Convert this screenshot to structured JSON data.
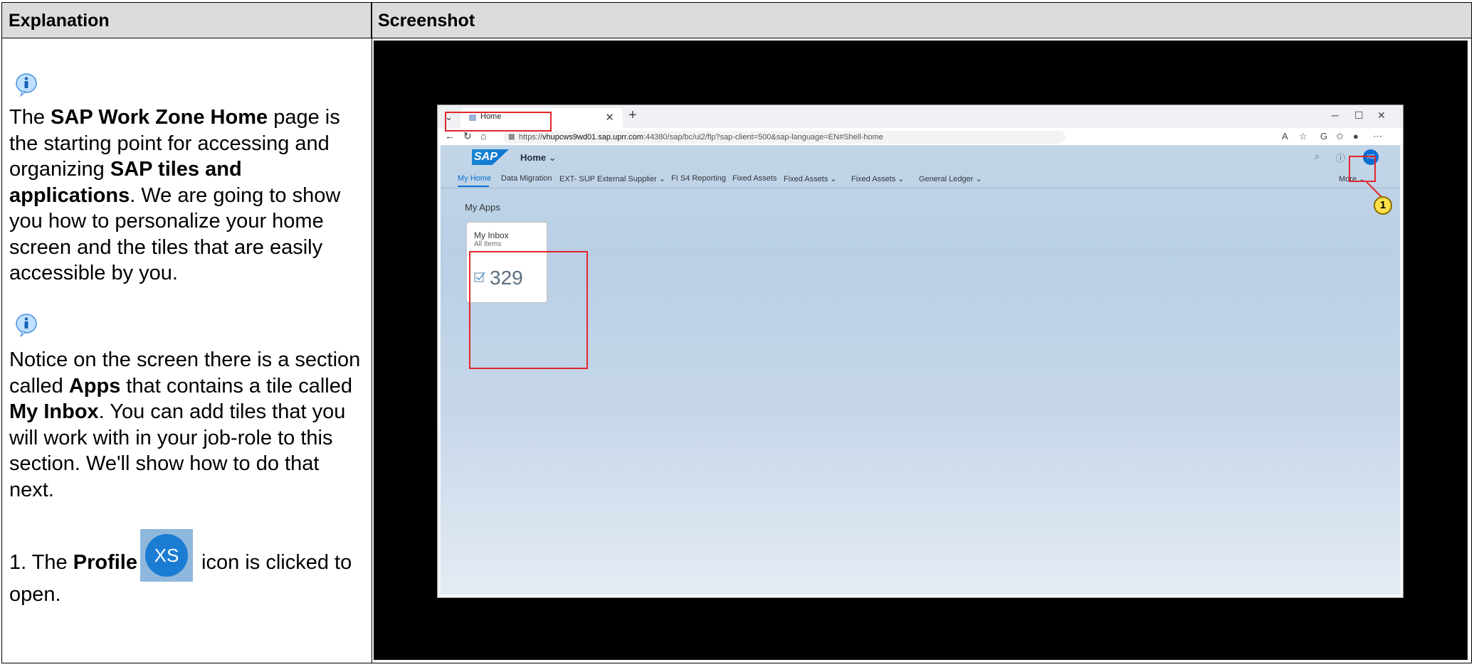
{
  "table": {
    "col1_header": "Explanation",
    "col2_header": "Screenshot"
  },
  "explanation": {
    "p1_a": "The ",
    "p1_b": "SAP Work Zone Home",
    "p1_c": " page is the starting point for accessing and organizing ",
    "p1_d": "SAP tiles and applications",
    "p1_e": ". We are going to show you how to personalize your home screen and the tiles that are easily accessible by you.",
    "p2_a": "Notice on the screen there is a section called ",
    "p2_b": "Apps",
    "p2_c": " that contains a tile called ",
    "p2_d": "My Inbox",
    "p2_e": ". You can add tiles that you will work with in your job-role to this section. We'll show how to do that next.",
    "step1_a": "1. The ",
    "step1_b": "Profile",
    "step1_icon_text": "XS",
    "step1_c": " icon is clicked to open."
  },
  "browser": {
    "tab_title": "Home",
    "url_prefix": "https://",
    "url_host": "vhupcws9wd01.sap.uprr.com",
    "url_rest": ":44380/sap/bc/ui2/flp?sap-client=500&sap-language=EN#Shell-home"
  },
  "sap": {
    "logo": "SAP",
    "home_title": "Home",
    "avatar_initials": "XS",
    "nav_items": [
      "My Home",
      "Data Migration",
      "EXT- SUP External Supplier",
      "FI S4 Reporting",
      "Fixed Assets",
      "Fixed Assets",
      "Fixed Assets",
      "General Ledger"
    ],
    "more": "More",
    "section_title": "My Apps",
    "tile": {
      "title": "My Inbox",
      "subtitle": "All Items",
      "count": "329"
    }
  },
  "callout_number": "1",
  "colors": {
    "highlight": "#e3262b",
    "sap_blue": "#0a6ed1",
    "callout": "#ffe04a"
  }
}
